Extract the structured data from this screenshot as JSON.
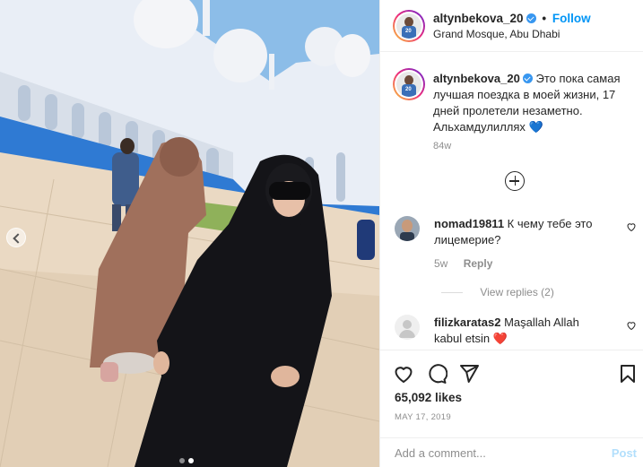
{
  "post": {
    "username": "altynbekova_20",
    "follow_separator": "•",
    "follow_label": "Follow",
    "location": "Grand Mosque, Abu Dhabi"
  },
  "caption": {
    "username": "altynbekova_20",
    "text": "Это пока самая лучшая поездка в моей жизни, 17 дней пролетели незаметно. Альхамдулиллях",
    "emoji": "💙",
    "time_ago": "84w"
  },
  "comments": [
    {
      "username": "nomad19811",
      "text": "К чему тебе это лицемерие?",
      "time_ago": "5w",
      "reply_label": "Reply",
      "view_replies": "View replies (2)"
    },
    {
      "username": "filizkaratas2",
      "text": "Maşallah Allah kabul etsin",
      "emoji": "❤️"
    }
  ],
  "actions": {
    "icons": [
      "heart-icon",
      "comment-icon",
      "share-icon",
      "bookmark-icon"
    ]
  },
  "likes": "65,092 likes",
  "date": "MAY 17, 2019",
  "add_comment": {
    "placeholder": "Add a comment...",
    "post_label": "Post"
  },
  "carousel": {
    "slides": 2,
    "active": 2
  },
  "colors": {
    "link": "#0095f6",
    "verified": "#3897f0",
    "muted": "#8e8e8e",
    "post_disabled": "#b2dffc",
    "heart_red": "#ed4956"
  }
}
